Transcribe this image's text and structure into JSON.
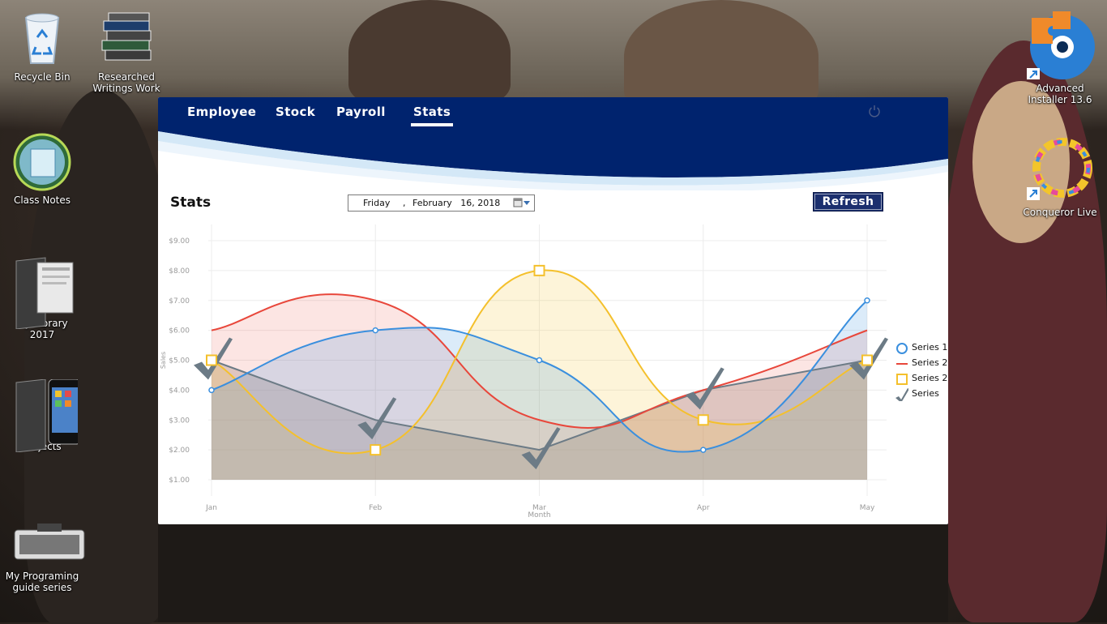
{
  "desktop": {
    "icons_left": [
      {
        "label": "Recycle Bin",
        "icon": "recycle-bin-icon"
      },
      {
        "label": "Researched Writings Work",
        "icon": "books-icon"
      },
      {
        "label": "Class Notes",
        "icon": "class-notes-icon"
      },
      {
        "label": "My Library 2017",
        "icon": "folder-icon"
      },
      {
        "label": "Projects",
        "icon": "phone-folder-icon"
      },
      {
        "label": "My Programing guide series",
        "icon": "keyboard-icon"
      }
    ],
    "icons_right": [
      {
        "label": "Advanced Installer 13.6",
        "icon": "advanced-installer-icon"
      },
      {
        "label": "Conqueror Live",
        "icon": "conqueror-live-icon"
      }
    ]
  },
  "app": {
    "nav": [
      "Employee",
      "Stock",
      "Payroll",
      "Stats"
    ],
    "active_tab": "Stats",
    "header_color": "#00236e",
    "title": "Stats",
    "date": {
      "day": "Friday",
      "sep": ",",
      "date": "February   16, 2018"
    },
    "refresh_label": "Refresh"
  },
  "chart_data": {
    "type": "area",
    "categories": [
      "Jan",
      "Feb",
      "Mar",
      "Apr",
      "May"
    ],
    "xlabel": "Month",
    "ylabel": "Sales",
    "ylim": [
      1,
      9
    ],
    "yticks": [
      "$1.00",
      "$2.00",
      "$3.00",
      "$4.00",
      "$5.00",
      "$6.00",
      "$7.00",
      "$8.00",
      "$9.00"
    ],
    "grid": true,
    "legend_position": "right",
    "series": [
      {
        "name": "Series 1",
        "values": [
          4,
          6,
          5,
          2,
          7
        ],
        "color": "#3a8fde",
        "marker": "circle",
        "smooth": true
      },
      {
        "name": "Series 2",
        "values": [
          6,
          7,
          3,
          4,
          6
        ],
        "color": "#e8473b",
        "marker": "none",
        "smooth": true
      },
      {
        "name": "Series 2",
        "values": [
          5,
          2,
          8,
          3,
          5
        ],
        "color": "#f4c02c",
        "marker": "square",
        "smooth": true
      },
      {
        "name": "Series",
        "values": [
          5,
          3,
          2,
          4,
          5
        ],
        "color": "#6c7b86",
        "marker": "check",
        "smooth": false
      }
    ]
  }
}
